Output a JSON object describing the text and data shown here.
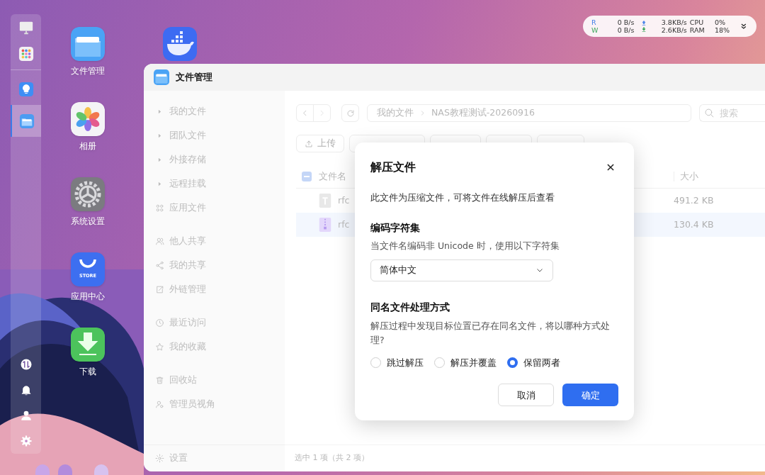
{
  "status_widget": {
    "read_label": "R",
    "read_rate": "0 B/s",
    "write_label": "W",
    "write_rate": "0 B/s",
    "upload_rate": "3.8KB/s",
    "download_rate": "2.6KB/s",
    "cpu_label": "CPU",
    "cpu_value": "0%",
    "ram_label": "RAM",
    "ram_value": "18%"
  },
  "dock": {
    "top_items": [
      {
        "kind": "monitor",
        "selected": false
      },
      {
        "kind": "apps",
        "selected": false
      }
    ],
    "app_items": [
      {
        "kind": "bulb",
        "selected": false
      },
      {
        "kind": "folder",
        "selected": true
      }
    ],
    "bottom_items": [
      {
        "kind": "transfer"
      },
      {
        "kind": "bell"
      },
      {
        "kind": "user"
      },
      {
        "kind": "gear"
      }
    ]
  },
  "desktop_icons": [
    {
      "kind": "folder",
      "label": "文件管理"
    },
    {
      "kind": "photos",
      "label": "相册"
    },
    {
      "kind": "settings",
      "label": "系统设置"
    },
    {
      "kind": "store",
      "label": "应用中心",
      "badge": "STORE"
    },
    {
      "kind": "download",
      "label": "下载"
    }
  ],
  "desktop_icons_2": [
    {
      "kind": "whale"
    }
  ],
  "window": {
    "title": "文件管理",
    "sidebar": {
      "groups": [
        {
          "items": [
            {
              "kind": "tree",
              "label": "我的文件"
            },
            {
              "kind": "tree",
              "label": "团队文件"
            },
            {
              "kind": "tree",
              "label": "外接存储"
            },
            {
              "kind": "tree",
              "label": "远程挂载"
            },
            {
              "kind": "apps",
              "label": "应用文件"
            }
          ]
        },
        {
          "items": [
            {
              "kind": "people",
              "label": "他人共享"
            },
            {
              "kind": "share",
              "label": "我的共享"
            },
            {
              "kind": "link",
              "label": "外链管理"
            }
          ]
        },
        {
          "items": [
            {
              "kind": "clock",
              "label": "最近访问"
            },
            {
              "kind": "star",
              "label": "我的收藏"
            }
          ]
        },
        {
          "items": [
            {
              "kind": "trash",
              "label": "回收站"
            },
            {
              "kind": "admin",
              "label": "管理员视角"
            }
          ]
        }
      ],
      "footer": "设置"
    },
    "path": [
      "我的文件",
      "NAS教程测试-20260916"
    ],
    "search": {
      "placeholder": "搜索"
    },
    "toolbar": [
      {
        "kind": "upload",
        "label": "上传"
      },
      {
        "kind": "covered"
      },
      {
        "kind": "covered"
      },
      {
        "kind": "covered"
      },
      {
        "kind": "covered"
      }
    ],
    "table": {
      "columns": [
        "文件名",
        "大小"
      ],
      "partially_selected": true,
      "rows": [
        {
          "kind": "text",
          "name": "rfc",
          "size": "491.2 KB",
          "selected": false
        },
        {
          "kind": "archive",
          "name": "rfc",
          "size": "130.4 KB",
          "selected": true
        }
      ]
    },
    "status_bar": "选中 1 项（共 2 项）"
  },
  "dialog": {
    "title": "解压文件",
    "description": "此文件为压缩文件，可将文件在线解压后查看",
    "charset_title": "编码字符集",
    "charset_hint": "当文件名编码非 Unicode 时，使用以下字符集",
    "charset_value": "简体中文",
    "conflict_title": "同名文件处理方式",
    "conflict_hint": "解压过程中发现目标位置已存在同名文件，将以哪种方式处理?",
    "options": [
      {
        "label": "跳过解压",
        "selected": false
      },
      {
        "label": "解压并覆盖",
        "selected": false
      },
      {
        "label": "保留两者",
        "selected": true
      }
    ],
    "cancel": "取消",
    "confirm": "确定"
  }
}
